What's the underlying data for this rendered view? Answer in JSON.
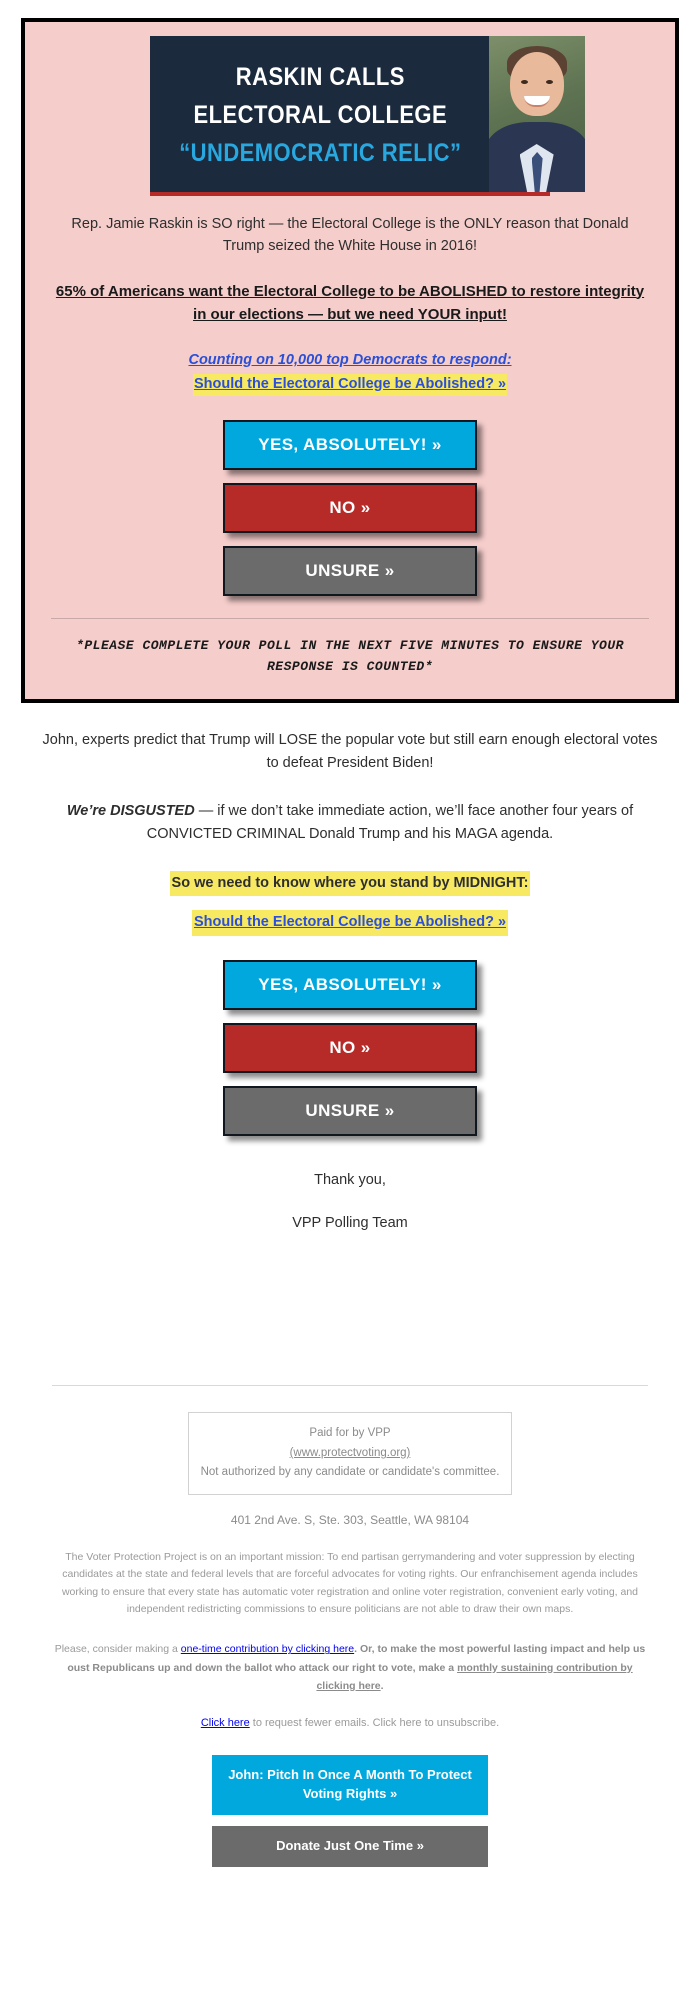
{
  "hero": {
    "banner": {
      "line1": "RASKIN CALLS",
      "line2": "ELECTORAL COLLEGE",
      "line3": "“UNDEMOCRATIC RELIC”",
      "photo_alt": "jamie-raskin-photo",
      "background_color": "#1b2a3d",
      "accent_color": "#29a8e0",
      "underline_color": "#b62a27"
    },
    "intro_paragraph": "Rep. Jamie Raskin is SO right — the Electoral College is the ONLY reason that Donald Trump seized the White House in 2016!",
    "stat_statement": "65% of Americans want the Electoral College to be ABOLISHED to restore integrity in our elections — but we need YOUR input!",
    "link_line_1": "Counting on 10,000 top Democrats to respond:",
    "link_line_2": "Should the Electoral College be Abolished? »",
    "buttons": [
      {
        "label": "YES, ABSOLUTELY! »",
        "color": "#00a8de",
        "style": "yes"
      },
      {
        "label": "NO »",
        "color": "#b62a27",
        "style": "no"
      },
      {
        "label": "UNSURE »",
        "color": "#6b6b6b",
        "style": "unsure"
      }
    ],
    "deadline_notice": "*PLEASE COMPLETE YOUR POLL IN THE NEXT FIVE MINUTES TO ENSURE YOUR RESPONSE IS COUNTED*",
    "background_color": "#f5cdcb"
  },
  "body": {
    "paragraph_1": "John, experts predict that Trump will LOSE the popular vote but still earn enough electoral votes to defeat President Biden!",
    "paragraph_2_lead": "We’re DISGUSTED",
    "paragraph_2_rest": " — if we don’t take immediate action, we’ll face another four years of CONVICTED CRIMINAL Donald Trump and his MAGA agenda.",
    "highlight_line": "So we need to know where you stand by MIDNIGHT:",
    "highlight_link": "Should the Electoral College be Abolished? »",
    "buttons": [
      {
        "label": "YES, ABSOLUTELY! »",
        "color": "#00a8de",
        "style": "yes"
      },
      {
        "label": "NO »",
        "color": "#b62a27",
        "style": "no"
      },
      {
        "label": "UNSURE »",
        "color": "#6b6b6b",
        "style": "unsure"
      }
    ],
    "signoff_1": "Thank you,",
    "signoff_2": "VPP Polling Team"
  },
  "footer": {
    "paid_for": "Paid for by VPP",
    "website": "(www.protectvoting.org)",
    "not_authorized": "Not authorized by any candidate or candidate's committee.",
    "address": "401 2nd Ave. S, Ste. 303, Seattle, WA 98104",
    "mission": "The Voter Protection Project is on an important mission: To end partisan gerrymandering and voter suppression by electing candidates at the state and federal levels that are forceful advocates for voting rights. Our enfranchisement agenda includes working to ensure that every state has automatic voter registration and online voter registration, convenient early voting, and independent redistricting commissions to ensure politicians are not able to draw their own maps.",
    "ask_pre": "Please, consider making a ",
    "ask_link_1": "one-time contribution by clicking here",
    "ask_mid": ". ",
    "ask_strong": "Or, to make the most powerful lasting impact and help us oust Republicans up and down the ballot who attack our right to vote, make a ",
    "ask_link_2": "monthly sustaining contribution by clicking here",
    "ask_end": ".",
    "unsub_link_1": "Click here",
    "unsub_mid": " to request fewer emails. Click here to unsubscribe.",
    "buttons": [
      {
        "label": "John: Pitch In Once A Month To Protect Voting Rights »",
        "color": "#00a8de",
        "style": "primary"
      },
      {
        "label": "Donate Just One Time »",
        "color": "#6b6b6b",
        "style": "secondary"
      }
    ]
  }
}
